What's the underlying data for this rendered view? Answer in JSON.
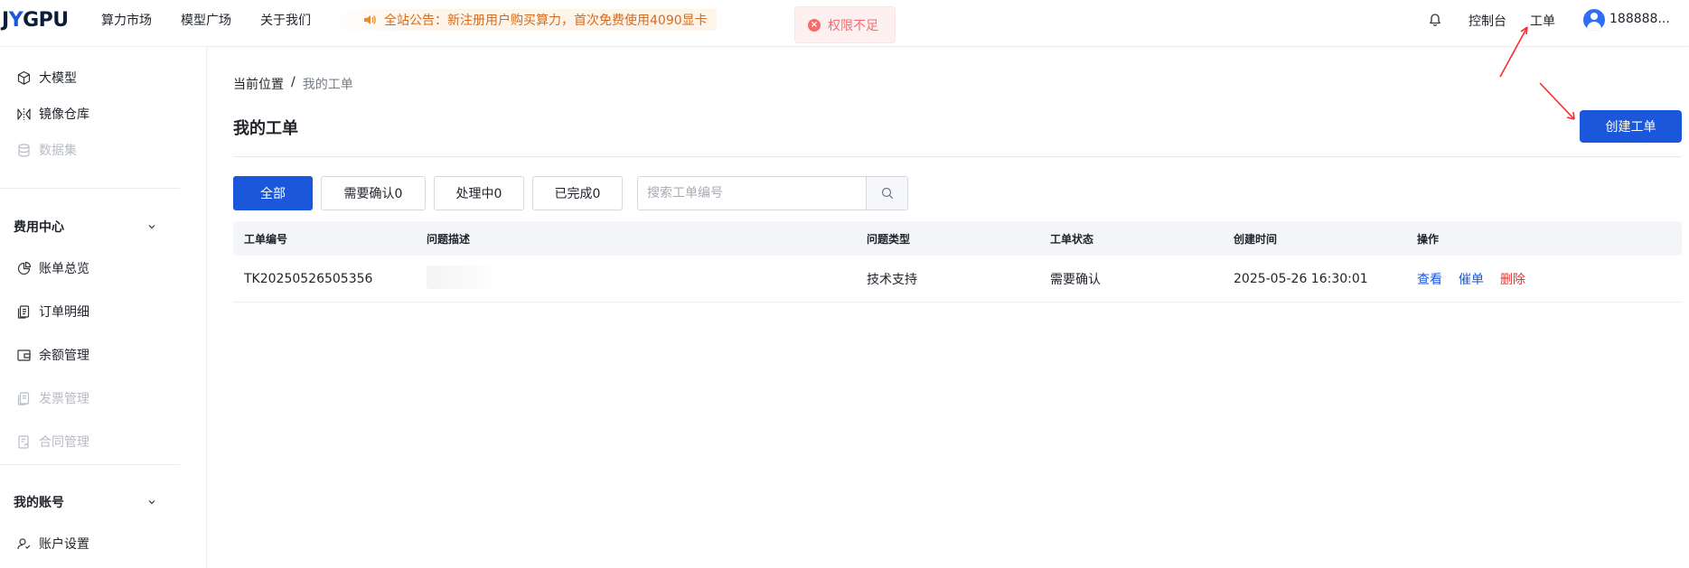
{
  "header": {
    "logo_pre": "J",
    "logo_mark": "Y",
    "logo_post": "GPU",
    "nav": [
      "算力市场",
      "模型广场",
      "关于我们"
    ],
    "notice": "全站公告：新注册用户购买算力，首次免费使用4090显卡",
    "toast": "权限不足",
    "console": "控制台",
    "ticket": "工单",
    "user": "188888...",
    "icons": {
      "bell": "bell-icon",
      "speaker": "speaker-icon",
      "avatar": "user-avatar"
    },
    "colors": {
      "notice_text": "#d46b1f",
      "toast_text": "#f56c6c",
      "primary": "#1a57db"
    }
  },
  "sidebar": {
    "top_items": [
      {
        "label": "大模型",
        "icon": "cube-icon",
        "enabled": true
      },
      {
        "label": "镜像仓库",
        "icon": "mirror-icon",
        "enabled": true
      },
      {
        "label": "数据集",
        "icon": "database-icon",
        "enabled": false
      }
    ],
    "billing": {
      "title": "费用中心",
      "items": [
        {
          "label": "账单总览",
          "icon": "pie-chart-icon",
          "enabled": true
        },
        {
          "label": "订单明细",
          "icon": "order-icon",
          "enabled": true
        },
        {
          "label": "余额管理",
          "icon": "wallet-icon",
          "enabled": true
        },
        {
          "label": "发票管理",
          "icon": "invoice-icon",
          "enabled": false
        },
        {
          "label": "合同管理",
          "icon": "contract-icon",
          "enabled": false
        }
      ]
    },
    "account": {
      "title": "我的账号",
      "items": [
        {
          "label": "账户设置",
          "icon": "account-settings-icon",
          "enabled": true
        }
      ]
    }
  },
  "main": {
    "breadcrumb": {
      "prefix": "当前位置",
      "sep": "/",
      "current": "我的工单"
    },
    "title": "我的工单",
    "create_button": "创建工单",
    "filters": [
      {
        "label": "全部",
        "active": true
      },
      {
        "label": "需要确认0",
        "active": false
      },
      {
        "label": "处理中0",
        "active": false
      },
      {
        "label": "已完成0",
        "active": false
      }
    ],
    "search": {
      "placeholder": "搜索工单编号",
      "value": ""
    },
    "table": {
      "columns": [
        "工单编号",
        "问题描述",
        "问题类型",
        "工单状态",
        "创建时间",
        "操作"
      ],
      "rows": [
        {
          "id": "TK20250526505356",
          "desc": "",
          "type": "技术支持",
          "status": "需要确认",
          "created": "2025-05-26 16:30:01",
          "actions": [
            "查看",
            "催单",
            "删除"
          ]
        }
      ]
    }
  },
  "annotation_color": "#ff2a2a"
}
